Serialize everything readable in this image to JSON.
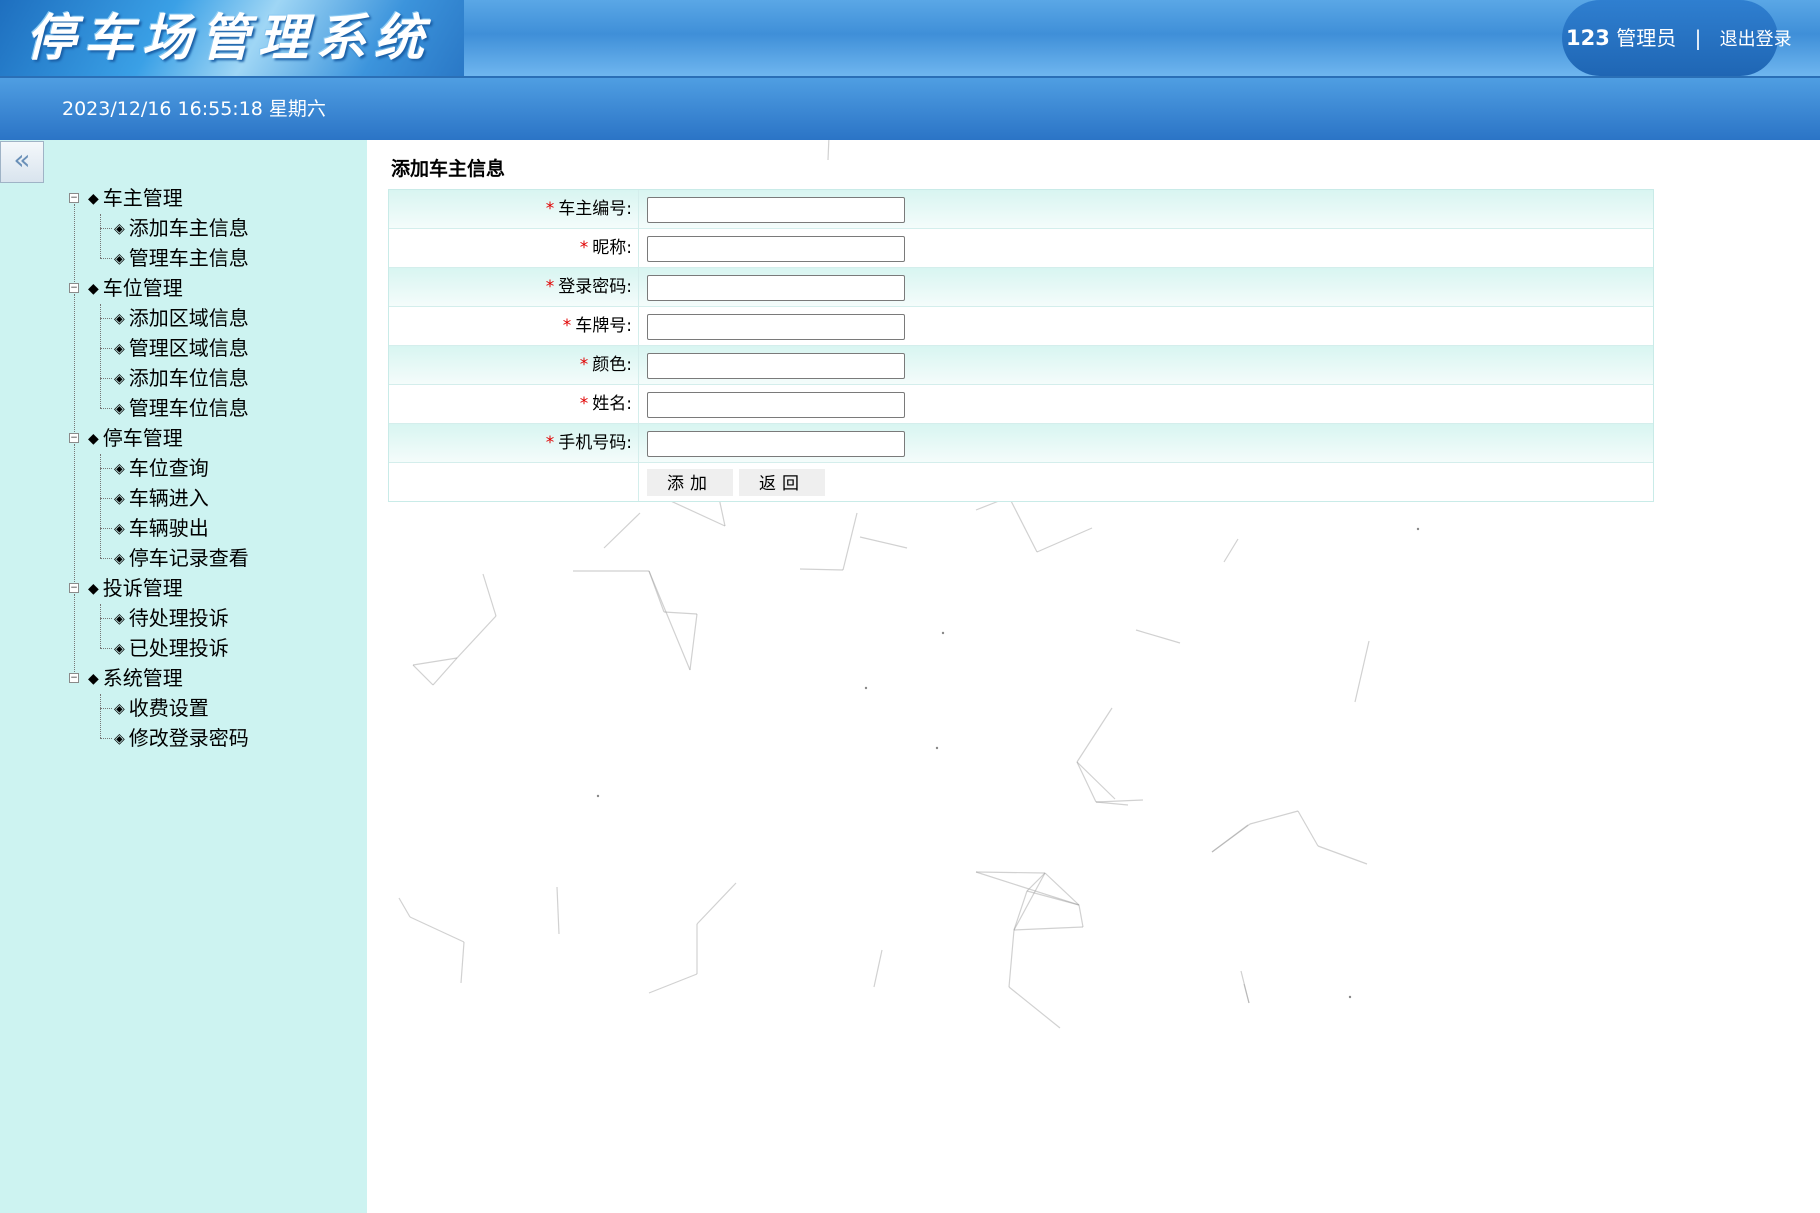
{
  "header": {
    "logo_text": "停车场管理系统",
    "user_id": "123",
    "user_role": "管理员",
    "separator": "|",
    "logout_label": "退出登录"
  },
  "subbar": {
    "datetime": "2023/12/16 16:55:18 星期六"
  },
  "sidebar": {
    "collapse_icon": "«",
    "groups": [
      {
        "label": "车主管理",
        "items": [
          "添加车主信息",
          "管理车主信息"
        ]
      },
      {
        "label": "车位管理",
        "items": [
          "添加区域信息",
          "管理区域信息",
          "添加车位信息",
          "管理车位信息"
        ]
      },
      {
        "label": "停车管理",
        "items": [
          "车位查询",
          "车辆进入",
          "车辆驶出",
          "停车记录查看"
        ]
      },
      {
        "label": "投诉管理",
        "items": [
          "待处理投诉",
          "已处理投诉"
        ]
      },
      {
        "label": "系统管理",
        "items": [
          "收费设置",
          "修改登录密码"
        ]
      }
    ]
  },
  "form": {
    "title": "添加车主信息",
    "required_mark": "*",
    "fields": [
      {
        "label": "车主编号:",
        "value": ""
      },
      {
        "label": "昵称:",
        "value": ""
      },
      {
        "label": "登录密码:",
        "value": ""
      },
      {
        "label": "车牌号:",
        "value": ""
      },
      {
        "label": "颜色:",
        "value": ""
      },
      {
        "label": "姓名:",
        "value": ""
      },
      {
        "label": "手机号码:",
        "value": ""
      }
    ],
    "add_label": "添加",
    "back_label": "返回"
  },
  "colors": {
    "header_blue": "#3f8fd8",
    "sidebar_bg": "#cdf3f1",
    "required_red": "#e00000"
  }
}
